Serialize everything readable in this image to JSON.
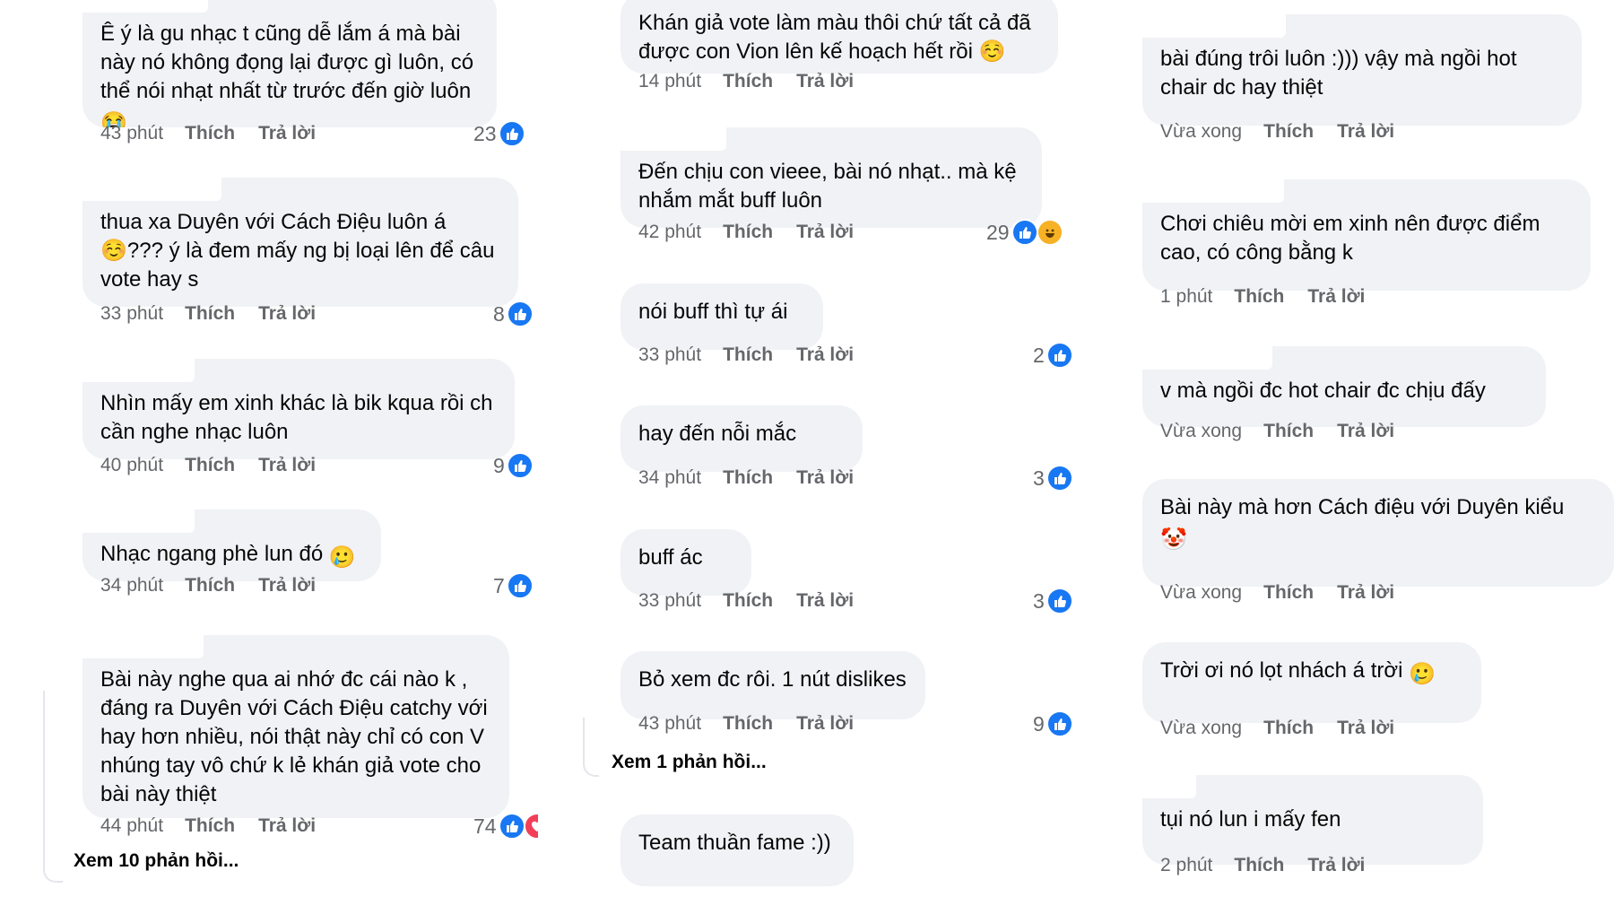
{
  "columns": [
    {
      "comments": [
        {
          "text": "Ê ý là gu nhạc t cũng dễ lắm á mà bài này nó không đọng lại được gì luôn, có thể nói nhạt nhất từ trước đến giờ luôn",
          "emoji": "😭",
          "time": "43 phút",
          "like": "Thích",
          "reply": "Trả lời",
          "count": "23",
          "reactions": [
            "like-icon"
          ]
        },
        {
          "text": "thua xa Duyên với Cách Điệu luôn á ☺️??? ý là đem mấy ng bị loại lên để câu vote hay s",
          "emoji": "",
          "time": "33 phút",
          "like": "Thích",
          "reply": "Trả lời",
          "count": "8",
          "reactions": [
            "like-icon"
          ]
        },
        {
          "text": "Nhìn mấy em xinh khác là bik kqua rồi ch cần nghe nhạc luôn",
          "emoji": "",
          "time": "40 phút",
          "like": "Thích",
          "reply": "Trả lời",
          "count": "9",
          "reactions": [
            "like-icon"
          ]
        },
        {
          "text": "Nhạc ngang phè lun đó",
          "emoji": "🥲",
          "time": "34 phút",
          "like": "Thích",
          "reply": "Trả lời",
          "count": "7",
          "reactions": [
            "like-icon"
          ]
        },
        {
          "text": "Bài này nghe qua ai nhớ đc cái nào k , đáng ra Duyên với Cách Điệu catchy với hay hơn nhiều, nói thật này chỉ có con V nhúng tay vô chứ k lẻ khán giả vote cho bài này thiệt",
          "emoji": "",
          "time": "44 phút",
          "like": "Thích",
          "reply": "Trả lời",
          "count": "74",
          "reactions": [
            "like-icon",
            "heart-icon"
          ]
        }
      ],
      "more": "Xem 10 phản hồi..."
    },
    {
      "comments": [
        {
          "text": "Khán giả vote làm màu thôi chứ tất cả đã được con Vion lên kế hoạch hết rồi ☺️",
          "emoji": "",
          "time": "14 phút",
          "like": "Thích",
          "reply": "Trả lời",
          "count": "",
          "reactions": []
        },
        {
          "text": "Đến chịu con vieee, bài nó nhạt.. mà kệ nhắm mắt buff luôn",
          "emoji": "",
          "time": "42 phút",
          "like": "Thích",
          "reply": "Trả lời",
          "count": "29",
          "reactions": [
            "like-icon",
            "haha-icon"
          ]
        },
        {
          "text": "nói buff thì tự ái",
          "emoji": "",
          "time": "33 phút",
          "like": "Thích",
          "reply": "Trả lời",
          "count": "2",
          "reactions": [
            "like-icon"
          ]
        },
        {
          "text": "hay đến nỗi mắc",
          "emoji": "",
          "time": "34 phút",
          "like": "Thích",
          "reply": "Trả lời",
          "count": "3",
          "reactions": [
            "like-icon"
          ]
        },
        {
          "text": "buff ác",
          "emoji": "",
          "time": "33 phút",
          "like": "Thích",
          "reply": "Trả lời",
          "count": "3",
          "reactions": [
            "like-icon"
          ]
        },
        {
          "text": "Bỏ xem đc rôi. 1 nút dislikes",
          "emoji": "",
          "time": "43 phút",
          "like": "Thích",
          "reply": "Trả lời",
          "count": "9",
          "reactions": [
            "like-icon"
          ]
        },
        {
          "text": "Team thuần fame :))",
          "emoji": "",
          "time": "",
          "like": "",
          "reply": "",
          "count": "",
          "reactions": []
        }
      ],
      "more": "Xem 1 phản hồi..."
    },
    {
      "comments": [
        {
          "text": "bài đúng trôi luôn :))) vậy mà ngồi hot chair dc hay thiệt",
          "emoji": "",
          "time": "Vừa xong",
          "like": "Thích",
          "reply": "Trả lời",
          "count": "",
          "reactions": []
        },
        {
          "text": "Chơi chiêu mời em xinh nên được điểm cao, có công bằng k",
          "emoji": "",
          "time": "1 phút",
          "like": "Thích",
          "reply": "Trả lời",
          "count": "",
          "reactions": []
        },
        {
          "text": "v mà ngồi đc hot chair đc chịu đấy",
          "emoji": "",
          "time": "Vừa xong",
          "like": "Thích",
          "reply": "Trả lời",
          "count": "",
          "reactions": []
        },
        {
          "text": "Bài này mà hơn Cách điệu với Duyên kiểu",
          "emoji": "🤡",
          "time": "Vừa xong",
          "like": "Thích",
          "reply": "Trả lời",
          "count": "",
          "reactions": []
        },
        {
          "text": "Trời ơi nó lọt nhách á trời",
          "emoji": "🥲",
          "time": "Vừa xong",
          "like": "Thích",
          "reply": "Trả lời",
          "count": "",
          "reactions": []
        },
        {
          "text": "tụi nó lun i mấy fen",
          "emoji": "",
          "time": "2 phút",
          "like": "Thích",
          "reply": "Trả lời",
          "count": "",
          "reactions": []
        }
      ],
      "more": ""
    }
  ],
  "colors": {
    "bubble": "#f0f2f5",
    "text": "#050505",
    "meta": "#65676b",
    "like": "#1877f2",
    "heart": "#f33e58",
    "haha": "#f7b125"
  }
}
